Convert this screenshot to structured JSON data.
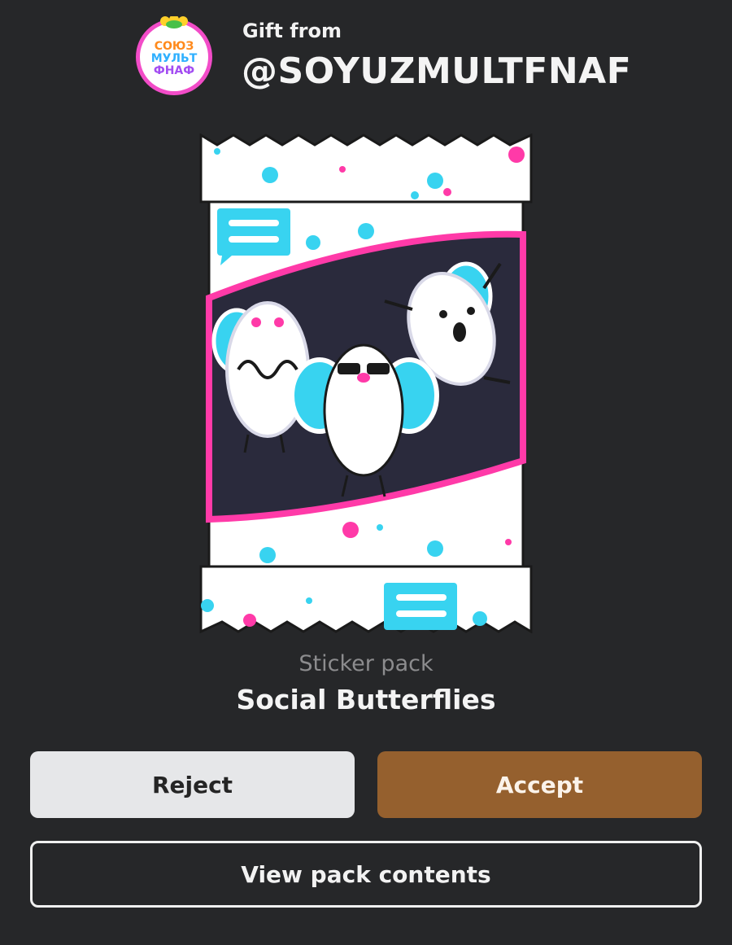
{
  "header": {
    "gift_label": "Gift from",
    "sender": "@SOYUZMULTFNAF",
    "avatar_text_lines": [
      "СОЮЗ",
      "МУЛЬТ",
      "ФНАФ"
    ]
  },
  "pack": {
    "type_label": "Sticker pack",
    "name": "Social Butterflies"
  },
  "actions": {
    "reject_label": "Reject",
    "accept_label": "Accept",
    "view_label": "View pack contents"
  },
  "colors": {
    "background": "#262729",
    "accept": "#95602e",
    "reject": "#e6e7e9",
    "accent_pink": "#ff3aa8",
    "accent_cyan": "#38d3f0"
  }
}
